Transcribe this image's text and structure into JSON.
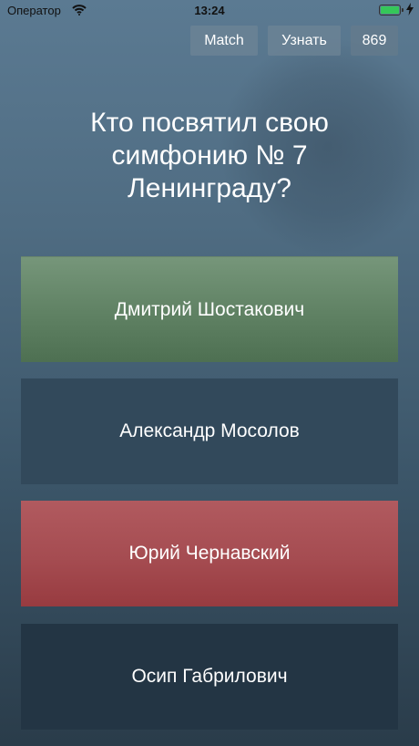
{
  "status_bar": {
    "carrier": "Оператор",
    "time": "13:24"
  },
  "toolbar": {
    "match_label": "Match",
    "learn_label": "Узнать",
    "score": "869"
  },
  "question": {
    "text": "Кто посвятил свою симфонию № 7 Ленинграду?"
  },
  "answers": [
    {
      "label": "Дмитрий Шостакович",
      "state": "correct"
    },
    {
      "label": "Александр Мосолов",
      "state": "neutral"
    },
    {
      "label": "Юрий Чернавский",
      "state": "wrong"
    },
    {
      "label": "Осип Габрилович",
      "state": "neutral"
    }
  ],
  "colors": {
    "correct": "#5f8163",
    "wrong": "#a54c51",
    "neutral": "#32495b",
    "background": "#4f6c82",
    "battery": "#35c759"
  },
  "icons": [
    "wifi-icon",
    "battery-icon",
    "charging-bolt-icon"
  ]
}
